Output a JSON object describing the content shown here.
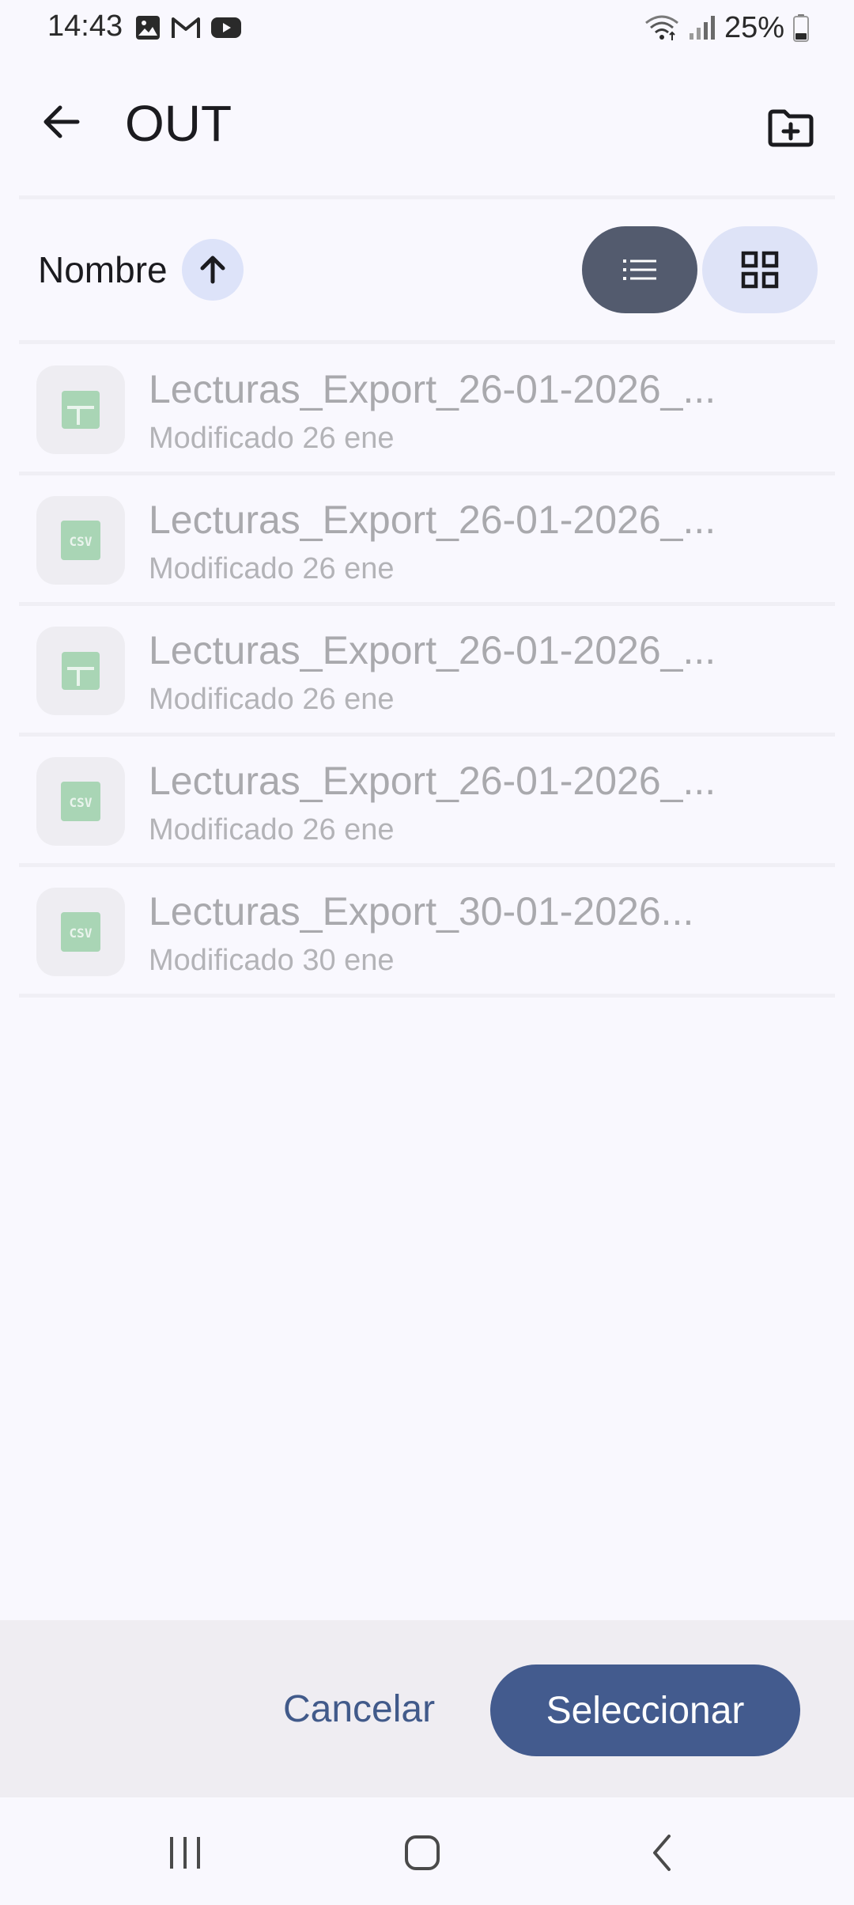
{
  "status_bar": {
    "time": "14:43",
    "battery_text": "25%",
    "left_icons": [
      "gallery-icon",
      "gmail-icon",
      "youtube-icon"
    ],
    "right_icons": [
      "wifi-icon",
      "signal-icon",
      "battery-icon"
    ]
  },
  "header": {
    "title": "OUT",
    "back_icon": "arrow-back-icon",
    "new_folder_icon": "create-new-folder-icon"
  },
  "sort": {
    "label": "Nombre",
    "direction": "ascending",
    "direction_icon": "arrow-up-icon"
  },
  "view_toggle": {
    "selected": "list",
    "list_icon": "list-view-icon",
    "grid_icon": "grid-view-icon"
  },
  "files": [
    {
      "name": "Lecturas_Export_26-01-2026_...",
      "modified": "Modificado 26 ene",
      "type": "spreadsheet",
      "icon": "spreadsheet-icon"
    },
    {
      "name": "Lecturas_Export_26-01-2026_...",
      "modified": "Modificado 26 ene",
      "type": "csv",
      "icon": "csv-icon",
      "icon_label": "CSV"
    },
    {
      "name": "Lecturas_Export_26-01-2026_...",
      "modified": "Modificado 26 ene",
      "type": "spreadsheet",
      "icon": "spreadsheet-icon"
    },
    {
      "name": "Lecturas_Export_26-01-2026_...",
      "modified": "Modificado 26 ene",
      "type": "csv",
      "icon": "csv-icon",
      "icon_label": "CSV"
    },
    {
      "name": "Lecturas_Export_30-01-2026...",
      "modified": "Modificado 30 ene",
      "type": "csv",
      "icon": "csv-icon",
      "icon_label": "CSV"
    }
  ],
  "actions": {
    "cancel_label": "Cancelar",
    "select_label": "Seleccionar"
  },
  "nav_bar": {
    "icons": [
      "recent-apps-icon",
      "home-icon",
      "back-icon"
    ]
  },
  "colors": {
    "background": "#f9f8fe",
    "accent": "#435b8e",
    "accent_text": "#415a8a",
    "file_icon_green": "#a9d5b5",
    "disabled_text": "#a9a9ad"
  }
}
